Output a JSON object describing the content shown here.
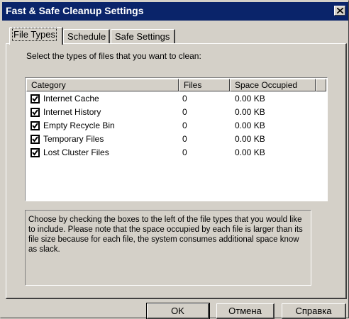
{
  "window": {
    "title": "Fast & Safe Cleanup Settings"
  },
  "tabs": [
    {
      "label": "File Types",
      "active": true
    },
    {
      "label": "Schedule",
      "active": false
    },
    {
      "label": "Safe Settings",
      "active": false
    }
  ],
  "instruction": "Select the types of files that you want to clean:",
  "table": {
    "columns": [
      "Category",
      "Files",
      "Space Occupied"
    ],
    "rows": [
      {
        "checked": true,
        "category": "Internet Cache",
        "files": "0",
        "space": "0.00 KB"
      },
      {
        "checked": true,
        "category": "Internet History",
        "files": "0",
        "space": "0.00 KB"
      },
      {
        "checked": true,
        "category": "Empty Recycle Bin",
        "files": "0",
        "space": "0.00 KB"
      },
      {
        "checked": true,
        "category": "Temporary Files",
        "files": "0",
        "space": "0.00 KB"
      },
      {
        "checked": true,
        "category": "Lost Cluster Files",
        "files": "0",
        "space": "0.00 KB"
      }
    ]
  },
  "description": "Choose by checking the boxes to the left of the file types that you would like to include.  Please note that the space occupied by each file is larger than its file size because for each file, the system consumes additional space know as slack.",
  "buttons": {
    "ok": "OK",
    "cancel": "Отмена",
    "help": "Справка"
  },
  "colors": {
    "titlebar": "#0a246a",
    "face": "#d4d0c8"
  },
  "icons": {
    "close": "close-icon",
    "check": "checkmark-icon"
  }
}
